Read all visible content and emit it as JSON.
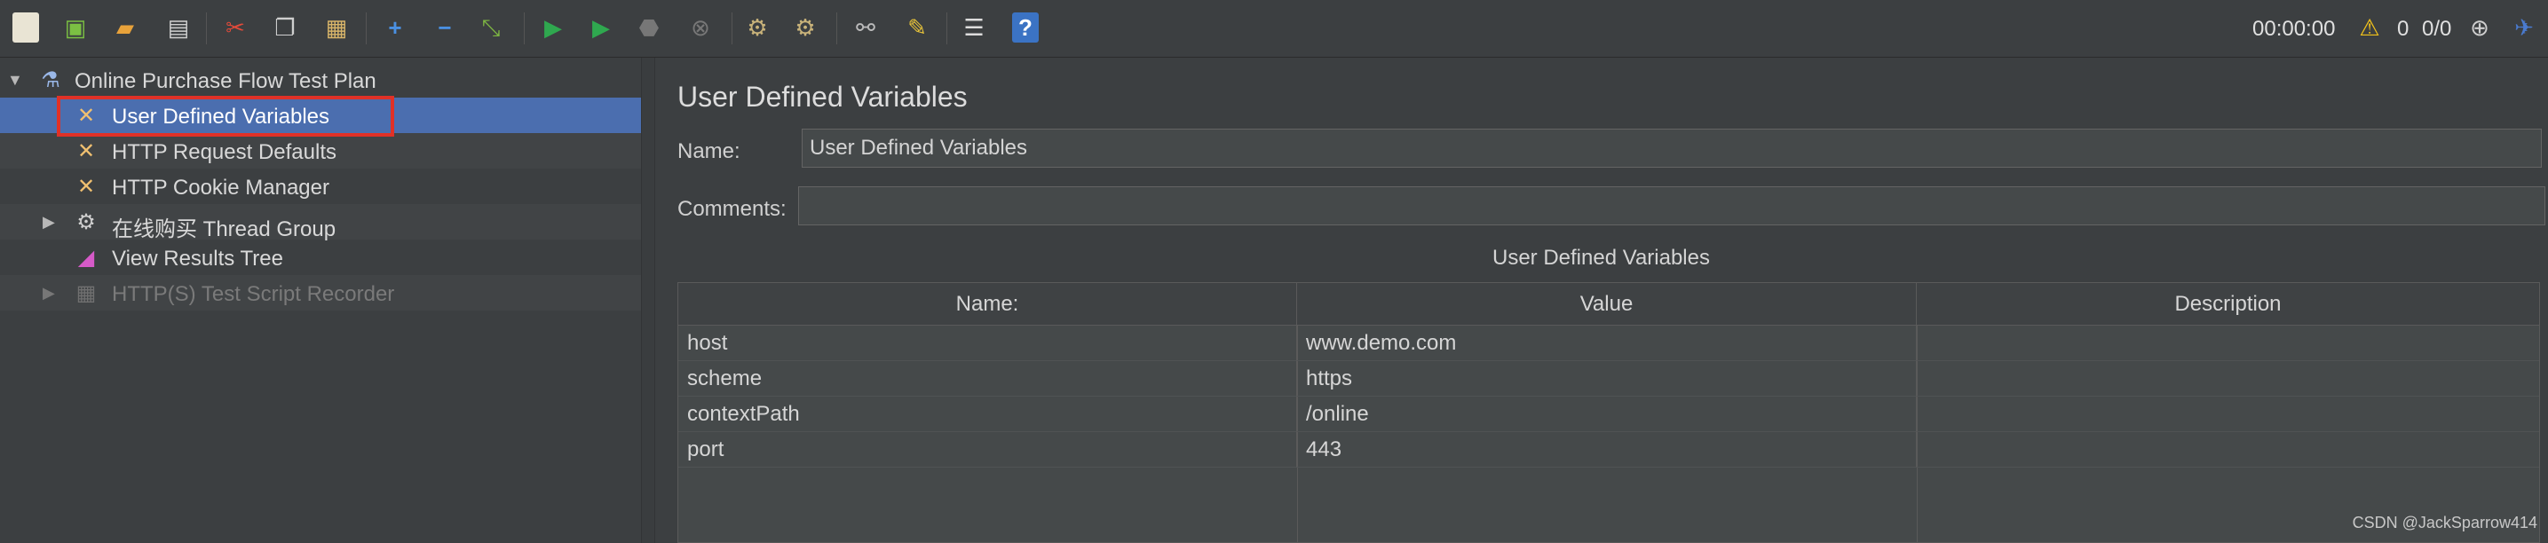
{
  "toolbar": {
    "icons": [
      "new-icon",
      "templates-icon",
      "open-icon",
      "save-icon",
      "cut-icon",
      "copy-icon",
      "paste-icon",
      "expand-icon",
      "collapse-icon",
      "toggle-icon",
      "start-icon",
      "start-no-pause-icon",
      "stop-icon",
      "shutdown-icon",
      "clear-icon",
      "clear-all-icon",
      "search-icon",
      "reset-search-icon",
      "function-helper-icon",
      "help-icon"
    ],
    "timer": "00:00:00",
    "warning_count": "0",
    "threads": "0/0"
  },
  "tree": {
    "items": [
      {
        "label": "Online Purchase Flow Test Plan",
        "icon": "test-plan-icon"
      },
      {
        "label": "User Defined Variables",
        "icon": "config-element-icon"
      },
      {
        "label": "HTTP Request Defaults",
        "icon": "config-element-icon"
      },
      {
        "label": "HTTP Cookie Manager",
        "icon": "config-element-icon"
      },
      {
        "label": "在线购买 Thread Group",
        "icon": "thread-group-gear-icon"
      },
      {
        "label": "View Results Tree",
        "icon": "listener-icon"
      },
      {
        "label": "HTTP(S) Test Script Recorder",
        "icon": "recorder-icon"
      }
    ]
  },
  "panel": {
    "title": "User Defined Variables",
    "name_label": "Name:",
    "name_value": "User Defined Variables",
    "comments_label": "Comments:",
    "comments_value": "",
    "table_caption": "User Defined Variables",
    "columns": [
      "Name:",
      "Value",
      "Description"
    ],
    "rows": [
      {
        "name": "host",
        "value": "www.demo.com",
        "description": ""
      },
      {
        "name": "scheme",
        "value": "https",
        "description": ""
      },
      {
        "name": "contextPath",
        "value": "/online",
        "description": ""
      },
      {
        "name": "port",
        "value": "443",
        "description": ""
      }
    ]
  },
  "watermark": "CSDN @JackSparrow414",
  "colors": {
    "selection": "#4b6eaf",
    "highlight_box": "#e03127",
    "background": "#3c3f41"
  }
}
